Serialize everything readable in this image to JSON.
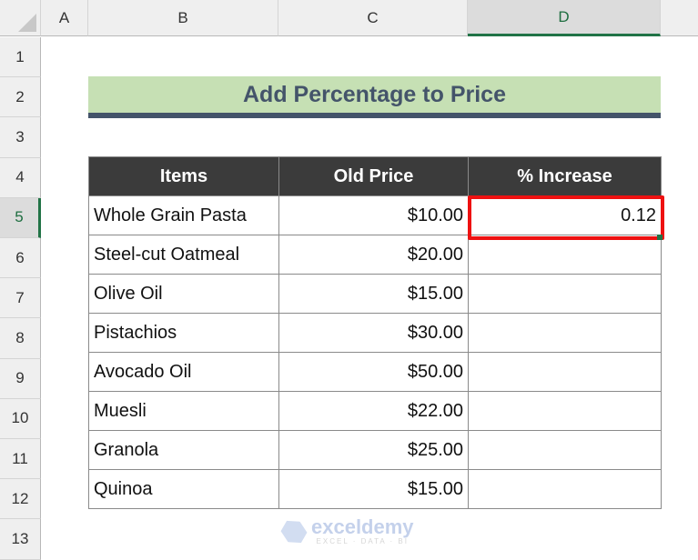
{
  "sheet": {
    "columns": [
      "A",
      "B",
      "C",
      "D"
    ],
    "selected_column": "D",
    "rows": [
      "1",
      "2",
      "3",
      "4",
      "5",
      "6",
      "7",
      "8",
      "9",
      "10",
      "11",
      "12",
      "13"
    ],
    "selected_row": "5"
  },
  "title": "Add Percentage to Price",
  "table": {
    "headers": [
      "Items",
      "Old Price",
      "% Increase"
    ],
    "rows": [
      {
        "item": "Whole Grain Pasta",
        "old_price": "$10.00",
        "increase": "0.12"
      },
      {
        "item": "Steel-cut Oatmeal",
        "old_price": "$20.00",
        "increase": ""
      },
      {
        "item": "Olive Oil",
        "old_price": "$15.00",
        "increase": ""
      },
      {
        "item": "Pistachios",
        "old_price": "$30.00",
        "increase": ""
      },
      {
        "item": "Avocado Oil",
        "old_price": "$50.00",
        "increase": ""
      },
      {
        "item": "Muesli",
        "old_price": "$22.00",
        "increase": ""
      },
      {
        "item": "Granola",
        "old_price": "$25.00",
        "increase": ""
      },
      {
        "item": "Quinoa",
        "old_price": "$15.00",
        "increase": ""
      }
    ]
  },
  "active_cell": "D5",
  "highlight_color": "#ee1111",
  "watermark": {
    "brand": "exceldemy",
    "tagline": "EXCEL · DATA · BI"
  }
}
